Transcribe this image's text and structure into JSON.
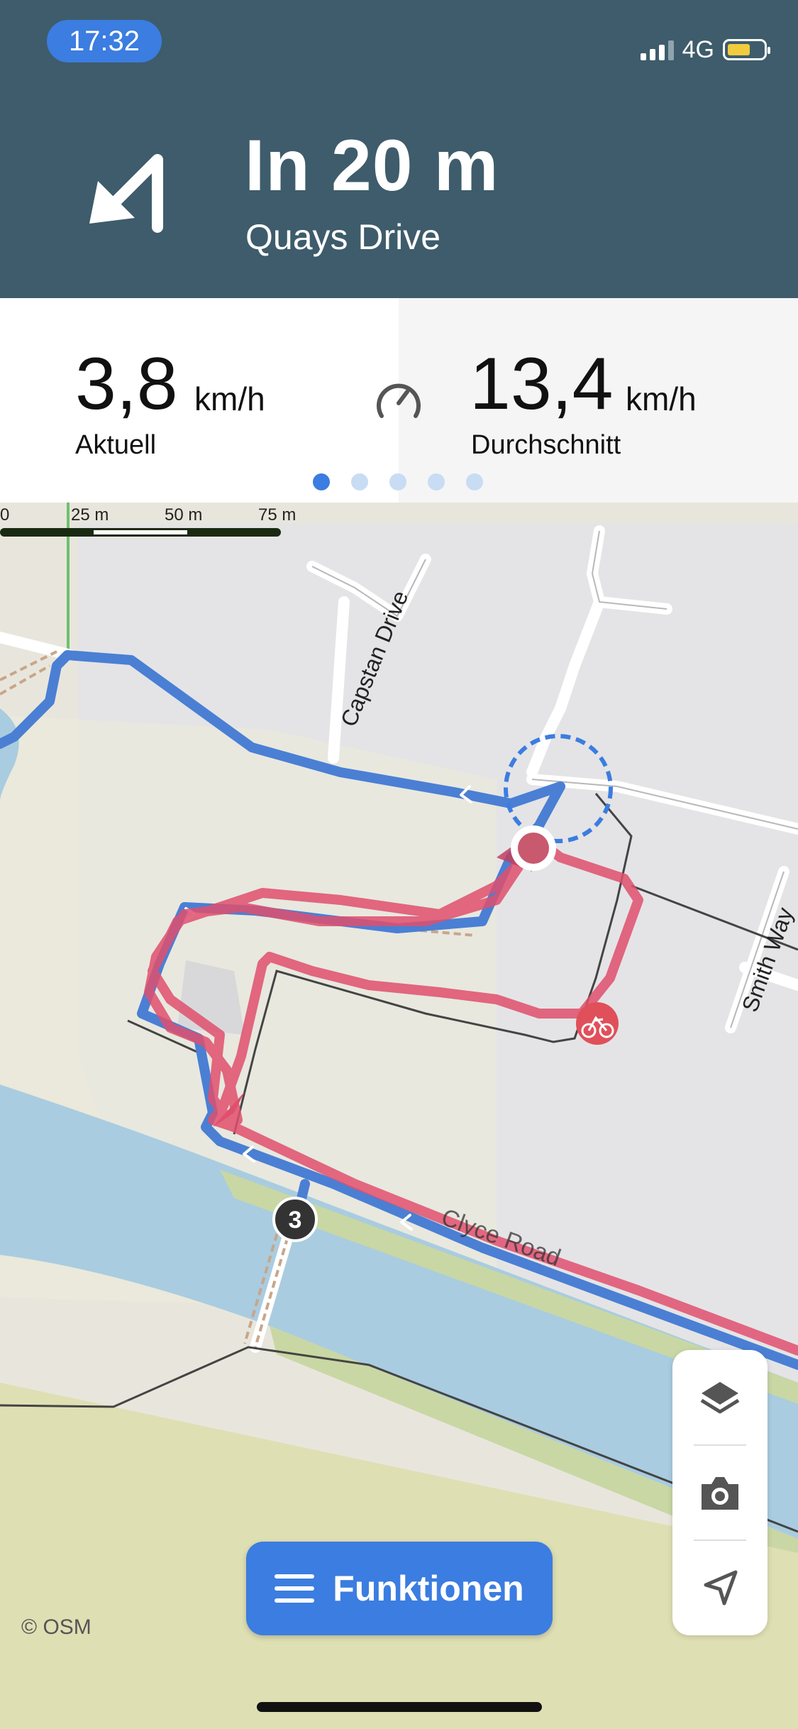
{
  "status_bar": {
    "time": "17:32",
    "network": "4G"
  },
  "navigation": {
    "distance": "In 20 m",
    "street": "Quays Drive",
    "maneuver_icon": "turn-left-arrow-icon"
  },
  "stats": {
    "current": {
      "value": "3,8",
      "unit": "km/h",
      "label": "Aktuell"
    },
    "average": {
      "value": "13,4",
      "unit": "km/h",
      "label": "Durchschnitt"
    },
    "pager": {
      "total": 5,
      "active_index": 0
    }
  },
  "map": {
    "scale_labels": [
      "0",
      "25 m",
      "50 m",
      "75 m"
    ],
    "street_labels": [
      "Capstan Drive",
      "Smith Way",
      "Clyce Road"
    ],
    "waypoint_badge": "3",
    "attribution": "© OSM",
    "colors": {
      "planned_route": "#4a7fd4",
      "recorded_track": "#e0506e",
      "water": "#a9cce0",
      "land": "#e8e6dc"
    }
  },
  "controls": {
    "functions_label": "Funktionen",
    "icons": [
      "layers-icon",
      "camera-icon",
      "locate-icon"
    ]
  }
}
